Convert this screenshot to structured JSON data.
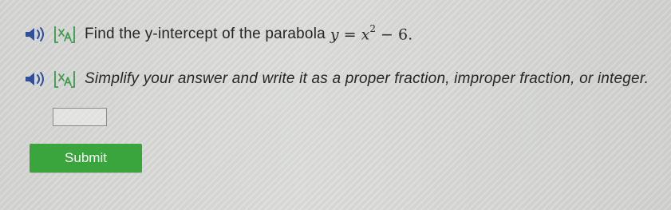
{
  "question": {
    "prompt": "Find the y-intercept of the parabola",
    "equation": {
      "lhs": "y",
      "eq": "=",
      "base": "x",
      "exponent": "2",
      "rest": "− 6."
    },
    "instruction": "Simplify your answer and write it as a proper fraction, improper fraction, or integer."
  },
  "answer": {
    "value": "",
    "placeholder": ""
  },
  "submit": {
    "label": "Submit"
  },
  "colors": {
    "submit_bg": "#3aa43d",
    "audio_icon": "#2f4f9a",
    "translate_icon": "#3c9a4b"
  },
  "icons": {
    "audio": "speaker-icon",
    "translate": "translate-icon"
  }
}
